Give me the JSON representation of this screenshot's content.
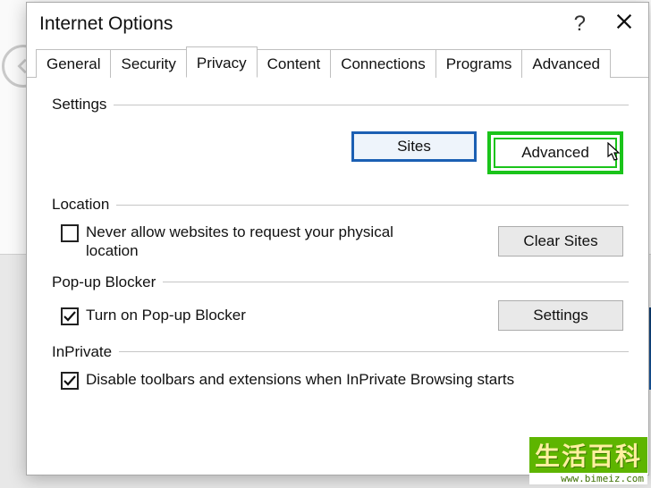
{
  "dialog": {
    "title": "Internet Options",
    "help_symbol": "?",
    "tabs": [
      "General",
      "Security",
      "Privacy",
      "Content",
      "Connections",
      "Programs",
      "Advanced"
    ],
    "active_tab_index": 2
  },
  "privacy": {
    "section_settings": "Settings",
    "button_sites": "Sites",
    "button_advanced": "Advanced",
    "section_location": "Location",
    "never_allow_label": "Never allow websites to request your physical location",
    "never_allow_checked": false,
    "button_clear_sites": "Clear Sites",
    "section_popup": "Pop-up Blocker",
    "popup_label": "Turn on Pop-up Blocker",
    "popup_checked": true,
    "button_popup_settings": "Settings",
    "section_inprivate": "InPrivate",
    "inprivate_label": "Disable toolbars and extensions when InPrivate Browsing starts",
    "inprivate_checked": true
  },
  "watermark": {
    "cn": "生活百科",
    "url": "www.bimeiz.com"
  }
}
